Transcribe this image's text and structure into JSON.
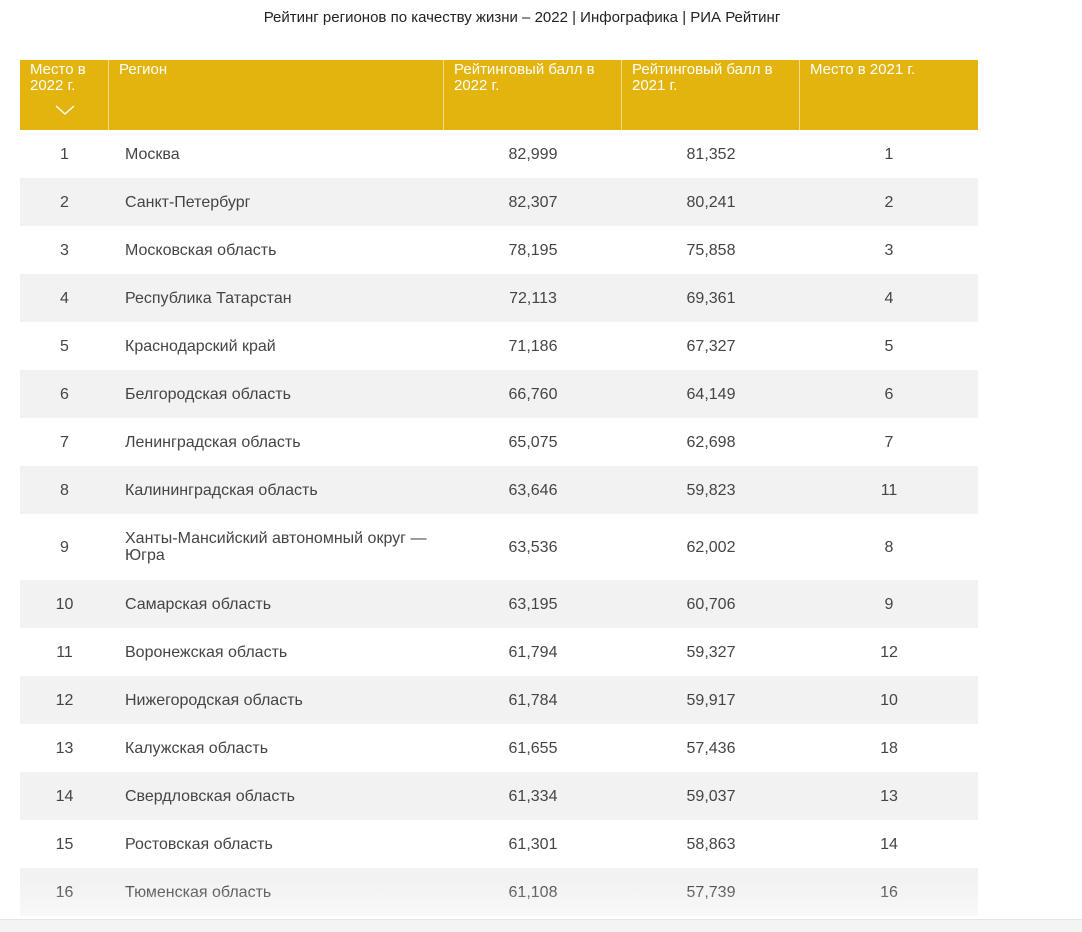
{
  "page": {
    "title": "Рейтинг регионов по качеству жизни – 2022 | Инфографика | РИА Рейтинг"
  },
  "table": {
    "headers": [
      "Место в 2022 г.",
      "Регион",
      "Рейтинговый балл в 2022 г.",
      "Рейтинговый балл в 2021 г.",
      "Место в 2021 г."
    ],
    "sorted_column_icon": "chevron-down-icon",
    "header_color": "#e2b40d",
    "rows": [
      {
        "place2022": "1",
        "region": "Москва",
        "score2022": "82,999",
        "score2021": "81,352",
        "place2021": "1"
      },
      {
        "place2022": "2",
        "region": "Санкт-Петербург",
        "score2022": "82,307",
        "score2021": "80,241",
        "place2021": "2"
      },
      {
        "place2022": "3",
        "region": "Московская область",
        "score2022": "78,195",
        "score2021": "75,858",
        "place2021": "3"
      },
      {
        "place2022": "4",
        "region": "Республика Татарстан",
        "score2022": "72,113",
        "score2021": "69,361",
        "place2021": "4"
      },
      {
        "place2022": "5",
        "region": "Краснодарский край",
        "score2022": "71,186",
        "score2021": "67,327",
        "place2021": "5"
      },
      {
        "place2022": "6",
        "region": "Белгородская область",
        "score2022": "66,760",
        "score2021": "64,149",
        "place2021": "6"
      },
      {
        "place2022": "7",
        "region": "Ленинградская область",
        "score2022": "65,075",
        "score2021": "62,698",
        "place2021": "7"
      },
      {
        "place2022": "8",
        "region": "Калининградская область",
        "score2022": "63,646",
        "score2021": "59,823",
        "place2021": "11"
      },
      {
        "place2022": "9",
        "region": "Ханты-Мансийский автономный округ — Югра",
        "score2022": "63,536",
        "score2021": "62,002",
        "place2021": "8"
      },
      {
        "place2022": "10",
        "region": "Самарская область",
        "score2022": "63,195",
        "score2021": "60,706",
        "place2021": "9"
      },
      {
        "place2022": "11",
        "region": "Воронежская область",
        "score2022": "61,794",
        "score2021": "59,327",
        "place2021": "12"
      },
      {
        "place2022": "12",
        "region": "Нижегородская область",
        "score2022": "61,784",
        "score2021": "59,917",
        "place2021": "10"
      },
      {
        "place2022": "13",
        "region": "Калужская область",
        "score2022": "61,655",
        "score2021": "57,436",
        "place2021": "18"
      },
      {
        "place2022": "14",
        "region": "Свердловская область",
        "score2022": "61,334",
        "score2021": "59,037",
        "place2021": "13"
      },
      {
        "place2022": "15",
        "region": "Ростовская область",
        "score2022": "61,301",
        "score2021": "58,863",
        "place2021": "14"
      },
      {
        "place2022": "16",
        "region": "Тюменская область",
        "score2022": "61,108",
        "score2021": "57,739",
        "place2021": "16"
      }
    ]
  }
}
